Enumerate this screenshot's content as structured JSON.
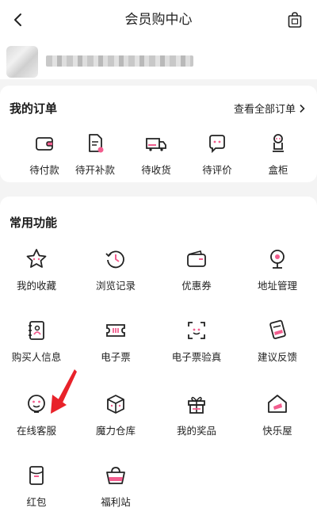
{
  "header": {
    "title": "会员购中心",
    "back_icon": "chevron-left-icon",
    "shop_icon": "shopping-bag-icon"
  },
  "orders": {
    "title": "我的订单",
    "view_all": "查看全部订单",
    "items": [
      {
        "label": "待付款",
        "icon": "wallet-icon"
      },
      {
        "label": "待开补款",
        "icon": "invoice-icon"
      },
      {
        "label": "待收货",
        "icon": "truck-icon"
      },
      {
        "label": "待评价",
        "icon": "comment-icon"
      },
      {
        "label": "盒柜",
        "icon": "figure-cabinet-icon"
      }
    ]
  },
  "functions": {
    "title": "常用功能",
    "items": [
      {
        "label": "我的收藏",
        "icon": "star-icon"
      },
      {
        "label": "浏览记录",
        "icon": "history-icon"
      },
      {
        "label": "优惠券",
        "icon": "coupon-wallet-icon"
      },
      {
        "label": "地址管理",
        "icon": "location-pin-icon"
      },
      {
        "label": "购买人信息",
        "icon": "contact-book-icon"
      },
      {
        "label": "电子票",
        "icon": "ticket-icon"
      },
      {
        "label": "电子票验真",
        "icon": "scan-verify-icon"
      },
      {
        "label": "建议反馈",
        "icon": "feedback-icon"
      },
      {
        "label": "在线客服",
        "icon": "customer-service-icon"
      },
      {
        "label": "魔力仓库",
        "icon": "box-icon"
      },
      {
        "label": "我的奖品",
        "icon": "gift-icon"
      },
      {
        "label": "快乐屋",
        "icon": "house-icon"
      },
      {
        "label": "红包",
        "icon": "red-envelope-icon"
      },
      {
        "label": "福利站",
        "icon": "basket-icon"
      }
    ]
  },
  "colors": {
    "accent": "#f25d8e",
    "annotation": "#e8222a"
  }
}
